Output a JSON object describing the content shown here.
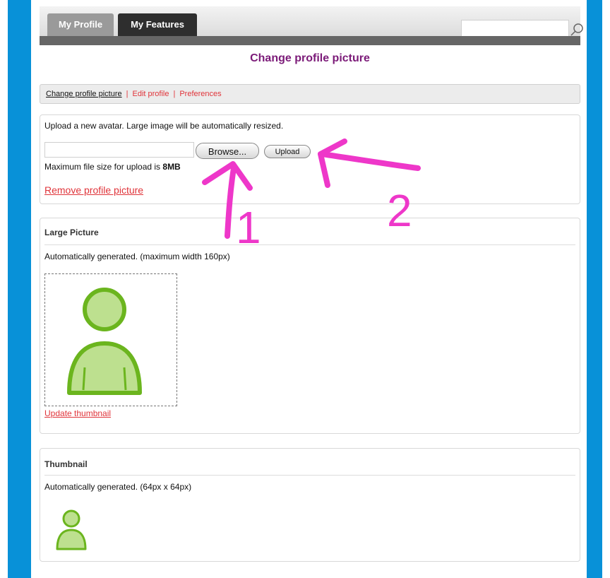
{
  "tabs": [
    {
      "label": "My Profile",
      "active": true
    },
    {
      "label": "My Features",
      "active": false
    }
  ],
  "search": {
    "value": "",
    "icon": "search-icon"
  },
  "page_title": "Change profile picture",
  "subnav": [
    {
      "label": "Change profile picture",
      "current": true
    },
    {
      "label": "Edit profile",
      "current": false
    },
    {
      "label": "Preferences",
      "current": false
    }
  ],
  "upload_section": {
    "intro": "Upload a new avatar. Large image will be automatically resized.",
    "browse_label": "Browse...",
    "upload_label": "Upload",
    "max_size_prefix": "Maximum file size for upload is ",
    "max_size_value": "8MB",
    "remove_link": "Remove profile picture"
  },
  "large_picture": {
    "heading": "Large Picture",
    "description": "Automatically generated. (maximum width 160px)",
    "update_link": "Update thumbnail"
  },
  "thumbnail": {
    "heading": "Thumbnail",
    "description": "Automatically generated. (64px x 64px)"
  },
  "annotations": {
    "arrow1_label": "1",
    "arrow2_label": "2"
  },
  "colors": {
    "sidebar_blue": "#0891d8",
    "title_purple": "#7b1a78",
    "link_red": "#e0343a",
    "avatar_green": "#6bb51e",
    "annotation_pink": "#ee37c9"
  }
}
